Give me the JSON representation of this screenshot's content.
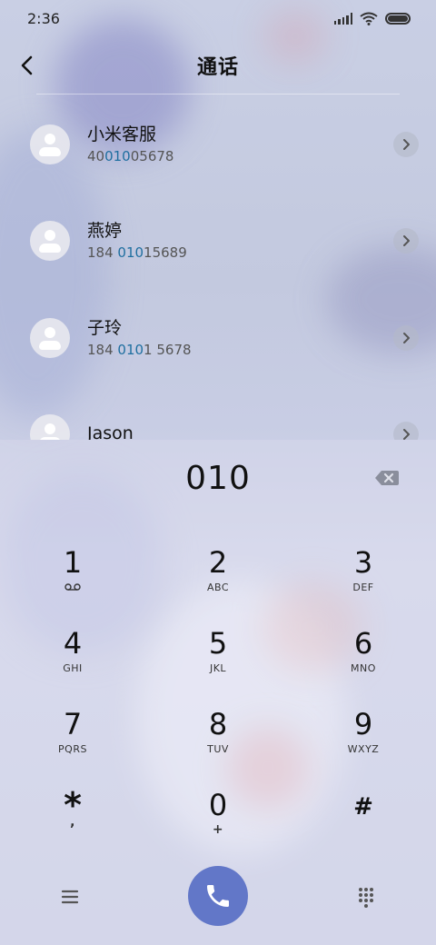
{
  "status_bar": {
    "time": "2:36"
  },
  "header": {
    "title": "通话"
  },
  "contacts": [
    {
      "name": "小米客服",
      "number_parts": [
        {
          "t": "40",
          "hl": false
        },
        {
          "t": "010",
          "hl": true
        },
        {
          "t": "05678",
          "hl": false
        }
      ]
    },
    {
      "name": "燕婷",
      "number_parts": [
        {
          "t": "184 ",
          "hl": false
        },
        {
          "t": "010",
          "hl": true
        },
        {
          "t": "15689",
          "hl": false
        }
      ]
    },
    {
      "name": "子玲",
      "number_parts": [
        {
          "t": "184 ",
          "hl": false
        },
        {
          "t": "010",
          "hl": true
        },
        {
          "t": "1 5678",
          "hl": false
        }
      ]
    },
    {
      "name": "Jason",
      "number_parts": []
    }
  ],
  "dialpad": {
    "typed_number": "010",
    "keys": [
      {
        "digit": "1",
        "letters": ""
      },
      {
        "digit": "2",
        "letters": "ABC"
      },
      {
        "digit": "3",
        "letters": "DEF"
      },
      {
        "digit": "4",
        "letters": "GHI"
      },
      {
        "digit": "5",
        "letters": "JKL"
      },
      {
        "digit": "6",
        "letters": "MNO"
      },
      {
        "digit": "7",
        "letters": "PQRS"
      },
      {
        "digit": "8",
        "letters": "TUV"
      },
      {
        "digit": "9",
        "letters": "WXYZ"
      },
      {
        "digit": "*",
        "letters": ","
      },
      {
        "digit": "0",
        "letters": "+"
      },
      {
        "digit": "#",
        "letters": ""
      }
    ]
  },
  "icons": {
    "back": "chevron-left-icon",
    "backspace": "backspace-icon",
    "voicemail": "voicemail-icon",
    "menu": "menu-icon",
    "call": "phone-icon",
    "keypad": "keypad-icon"
  },
  "colors": {
    "call_button": "#6277c8",
    "match_highlight": "#1f6fa0"
  }
}
